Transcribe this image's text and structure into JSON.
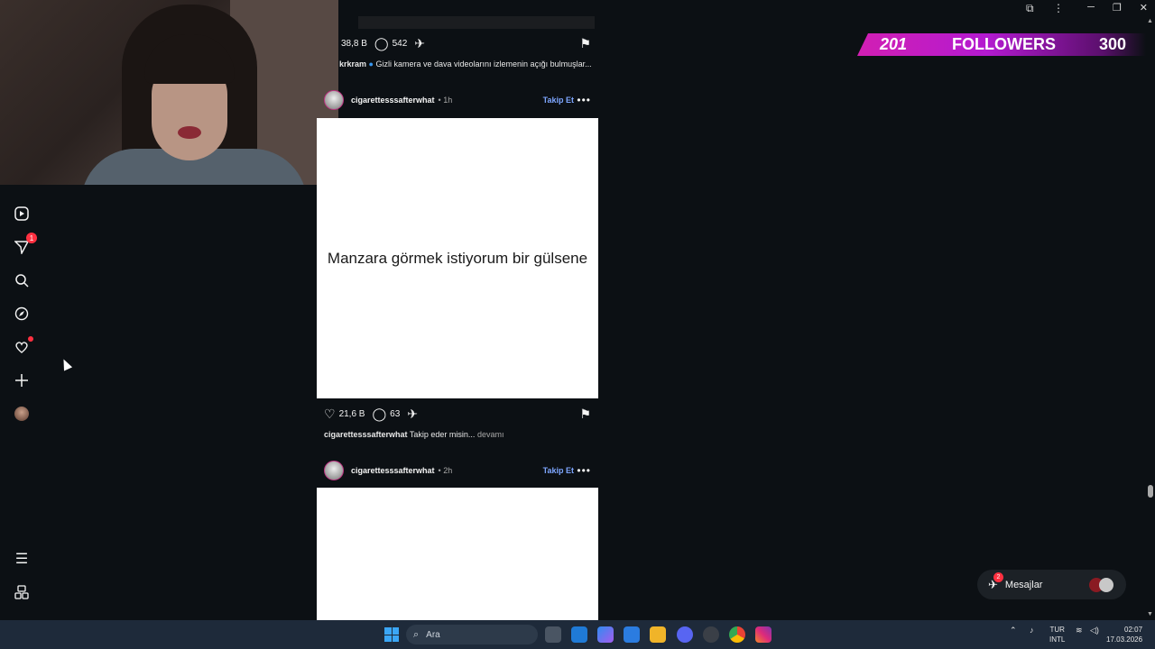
{
  "window": {
    "minimize": "─",
    "restore": "❐",
    "close": "✕",
    "extension_icon": "puzzle-icon",
    "menu_icon": "kebab-icon"
  },
  "nav": {
    "items": [
      {
        "name": "reels",
        "icon": "⊳"
      },
      {
        "name": "messages",
        "icon": "✈",
        "badge": "1"
      },
      {
        "name": "search",
        "icon": "⌕"
      },
      {
        "name": "explore",
        "icon": "⊘"
      },
      {
        "name": "notifications",
        "icon": "♡"
      },
      {
        "name": "create",
        "icon": "+"
      },
      {
        "name": "profile",
        "icon": ""
      }
    ],
    "more_icon": "☰",
    "threads_icon": "⌘"
  },
  "feed": {
    "prev_post": {
      "likes": "38,8 B",
      "comments": "542",
      "caption_user": "krkram",
      "caption_text": "Gizli kamera ve dava videolarını izlemenin açığı bulmuşlar..."
    },
    "post1": {
      "username": "cigarettesssafterwhat",
      "time": "1h",
      "follow": "Takip Et",
      "more": "•••",
      "image_text": "Manzara görmek istiyorum bir gülsene",
      "likes": "21,6 B",
      "comments": "63",
      "caption_user": "cigarettesssafterwhat",
      "caption_text": "Takip eder misin...",
      "caption_more": "devamı"
    },
    "post2": {
      "username": "cigarettesssafterwhat",
      "time": "2h",
      "follow": "Takip Et",
      "more": "•••"
    }
  },
  "overlay": {
    "current": "201",
    "label": "FOLLOWERS",
    "goal": "300"
  },
  "messages": {
    "label": "Mesajlar",
    "badge": "2"
  },
  "taskbar": {
    "search_placeholder": "Ara",
    "lang_top": "TUR",
    "lang_bottom": "INTL",
    "time": "02:07",
    "date": "17.03.2026"
  },
  "colors": {
    "background": "#0c1014",
    "follow_link": "#7ea6ff",
    "badge": "#ff3040",
    "overlay_magenta": "#d21fb3",
    "taskbar": "#1e2a3a"
  }
}
